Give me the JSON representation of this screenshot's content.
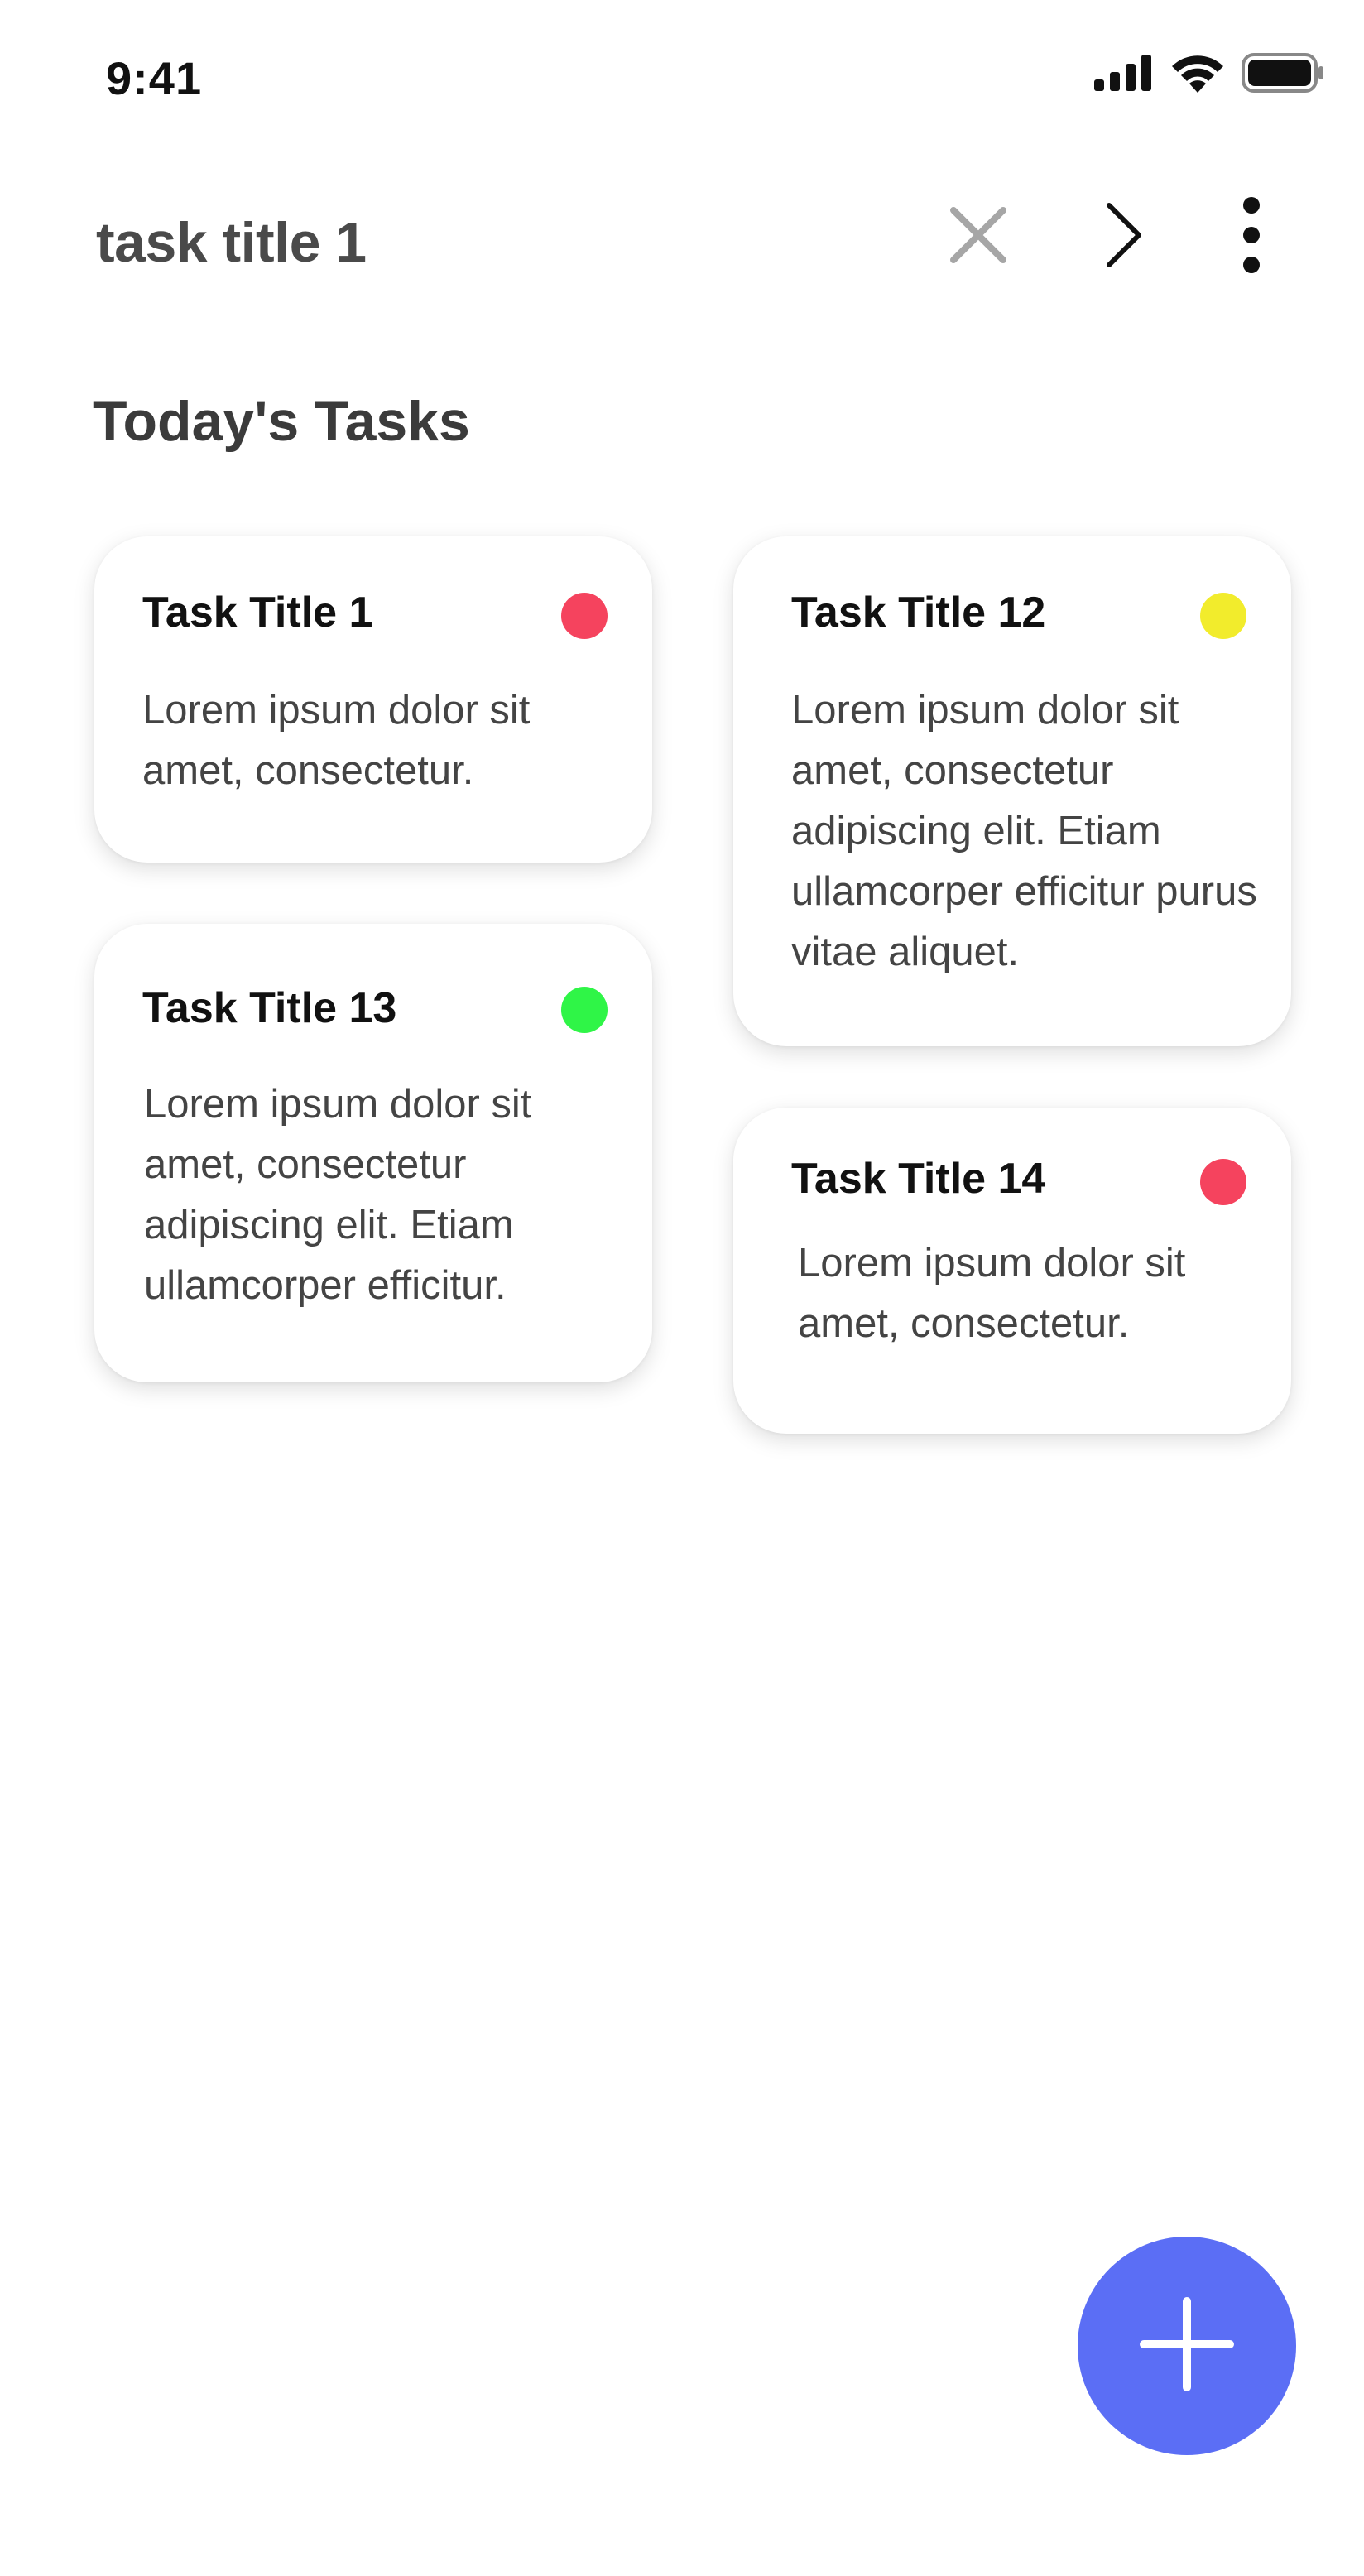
{
  "status_bar": {
    "time": "9:41",
    "icons": [
      "signal-icon",
      "wifi-icon",
      "battery-icon"
    ]
  },
  "search": {
    "value": "task title 1",
    "clear_icon": "close-icon",
    "next_icon": "chevron-right-icon",
    "more_icon": "more-vertical-icon"
  },
  "section": {
    "title": "Today's Tasks"
  },
  "tasks": [
    {
      "title": "Task Title 1",
      "body": "Lorem ipsum dolor sit amet, consectetur.",
      "status_color": "#f5435e"
    },
    {
      "title": "Task Title 12",
      "body": "Lorem ipsum dolor sit amet, consectetur adipiscing elit. Etiam ullamcorper efficitur purus vitae aliquet.",
      "status_color": "#f2ec2c"
    },
    {
      "title": "Task Title 13",
      "body": "Lorem ipsum dolor sit amet, consectetur adipiscing elit. Etiam ullamcorper efficitur.",
      "status_color": "#2ff547"
    },
    {
      "title": "Task Title 14",
      "body": "Lorem ipsum dolor sit amet, consectetur.",
      "status_color": "#f5435e"
    }
  ],
  "fab": {
    "icon": "plus-icon",
    "color": "#5b6ef5"
  }
}
